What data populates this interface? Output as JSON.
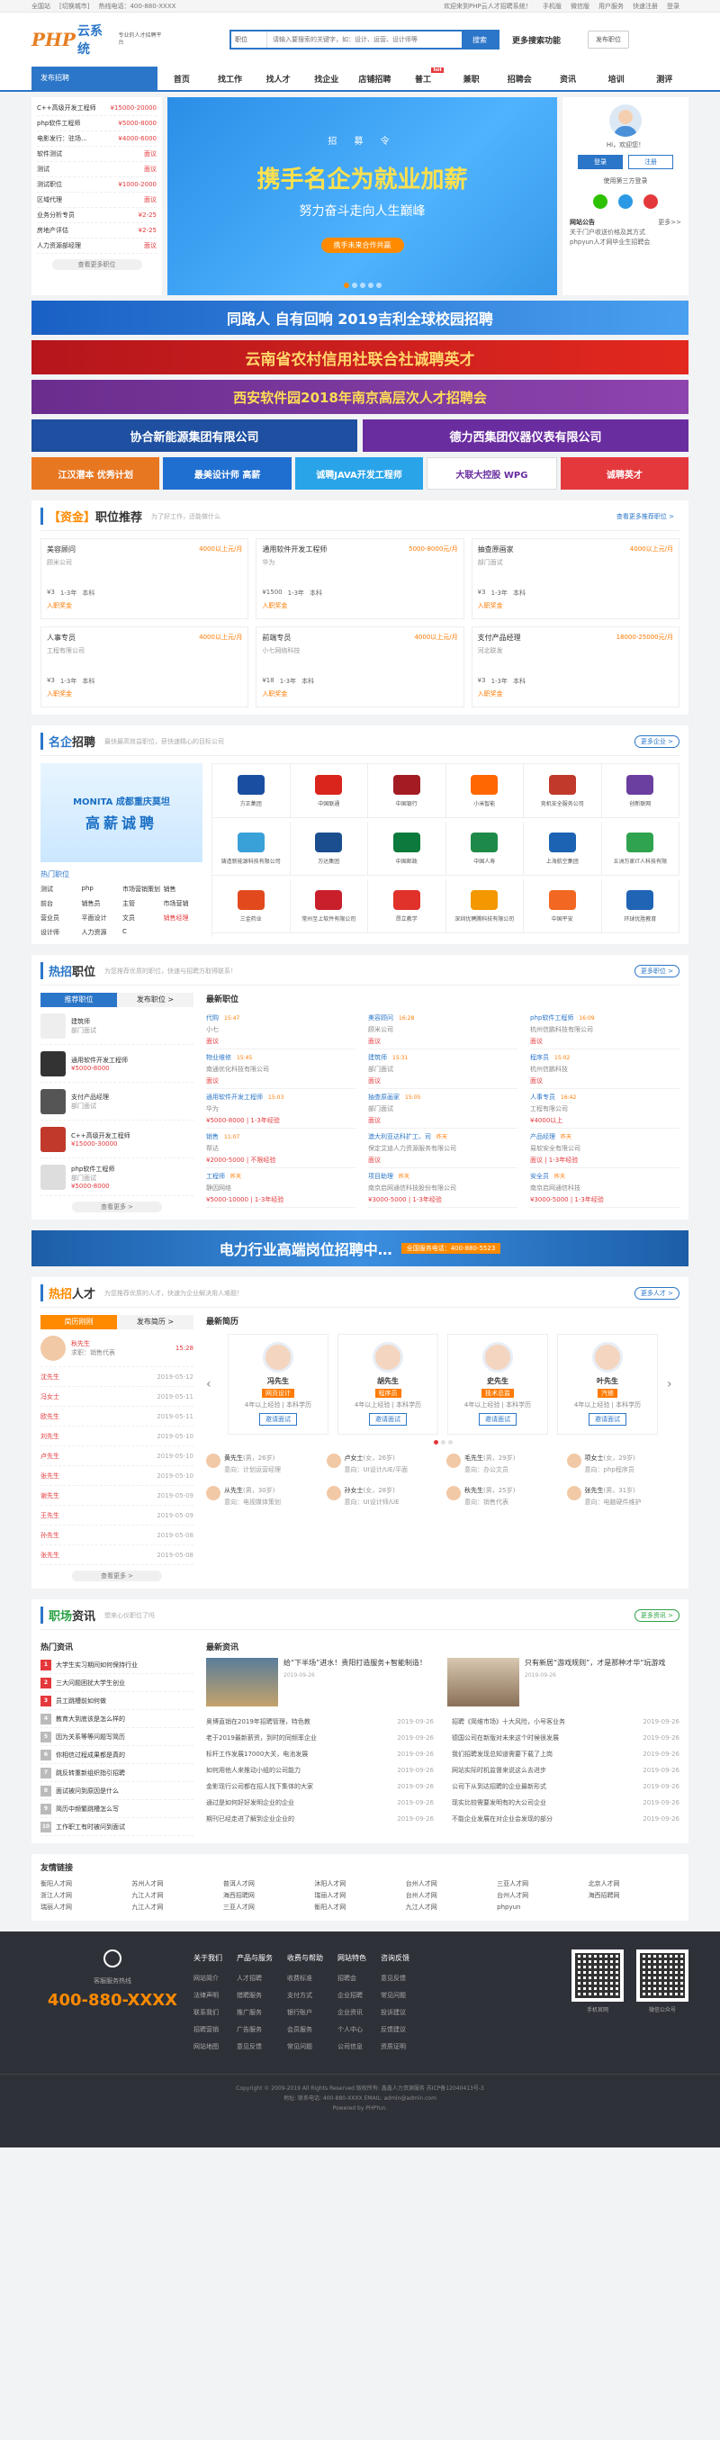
{
  "topbar": {
    "city": "全国站",
    "switch": "[切换城市]",
    "hotline": "热线电话：400-880-XXXX",
    "welcome": "欢迎来到PHP云人才招聘系统！",
    "links": [
      "手机版",
      "微信版",
      "用户服务",
      "快速注册",
      "登录"
    ]
  },
  "header": {
    "logo_php": "PHP",
    "logo_cn": "云系统",
    "logo_sub": "专业的人才招聘平台",
    "search_select": "职位",
    "search_placeholder": "请输入要搜索的关键字，如：设计、运营、设计师等",
    "search_btn": "搜索",
    "more": "更多搜索功能",
    "post_btn": "发布职位"
  },
  "nav": {
    "left": "发布招聘",
    "items": [
      "首页",
      "找工作",
      "找人才",
      "找企业",
      "店铺招聘",
      "普工",
      "兼职",
      "招聘会",
      "资讯",
      "培训",
      "测评"
    ]
  },
  "sidemenu": {
    "items": [
      {
        "n": "C++高级开发工程师",
        "p": "¥15000-20000"
      },
      {
        "n": "php软件工程师",
        "p": "¥5000-8000"
      },
      {
        "n": "电影发行：驻场...",
        "p": "¥4000-6000"
      },
      {
        "n": "软件测试",
        "p": "面议"
      },
      {
        "n": "测试",
        "p": "面议"
      },
      {
        "n": "测试职位",
        "p": "¥1000-2000"
      },
      {
        "n": "区域代理",
        "p": "面议"
      },
      {
        "n": "业务分析专员",
        "p": "¥2-25"
      },
      {
        "n": "房地产评估",
        "p": "¥2-25"
      },
      {
        "n": "人力资源部经理",
        "p": "面议"
      }
    ],
    "more": "查看更多职位"
  },
  "banner": {
    "tag": "招 募 令",
    "big": "携手名企为就业加薪",
    "mid": "努力奋斗走向人生巅峰",
    "btn": "携手未来合作共赢"
  },
  "login": {
    "hi": "Hi，欢迎您！",
    "btn_login": "登录",
    "btn_reg": "注册",
    "third": "使用第三方登录",
    "notice_title": "网站公告",
    "notice_more": "更多>>",
    "notice": "关于门户收送价格及其方式",
    "notice2": "phpyun人才网毕业生招聘会"
  },
  "ads": {
    "geely": "同路人 自有回响   2019吉利全球校园招聘",
    "yunnan": "云南省农村信用社联合社诚聘英才",
    "xian": "西安软件园2018年南京高层次人才招聘会",
    "cne": "协合新能源集团有限公司",
    "delixi": "德力西集团仪器仪表有限公司",
    "small": [
      "江汉潜本 优秀计划",
      "最美设计师 高薪",
      "诚聘JAVA开发工程师",
      "大联大控股 WPG",
      "诚聘英才"
    ]
  },
  "recommend": {
    "title_a": "【资金】",
    "title_b": "职位推荐",
    "sub": "为了好工作，还能做什么",
    "more": "查看更多推荐职位 >",
    "jobs": [
      {
        "n": "美容顾问",
        "s": "4000以上元/月",
        "c": "顾米公司",
        "t": [
          "¥3",
          "1-3年",
          "本科"
        ],
        "b": "入职奖金"
      },
      {
        "n": "通用软件开发工程师",
        "s": "5000-8000元/月",
        "c": "华为",
        "t": [
          "¥1500",
          "1-3年",
          "本科"
        ],
        "b": "入职奖金"
      },
      {
        "n": "抽查原画家",
        "s": "4000以上元/月",
        "c": "部门面试",
        "t": [
          "¥3",
          "1-3年",
          "本科"
        ],
        "b": "入职奖金"
      },
      {
        "n": "人事专员",
        "s": "4000以上元/月",
        "c": "工程有限公司",
        "t": [
          "¥3",
          "1-3年",
          "本科"
        ],
        "b": "入职奖金"
      },
      {
        "n": "前端专员",
        "s": "4000以上元/月",
        "c": "小七网络科技",
        "t": [
          "¥18",
          "1-3年",
          "本科"
        ],
        "b": "入职奖金"
      },
      {
        "n": "支付产品经理",
        "s": "18000-25000元/月",
        "c": "河北联发",
        "t": [
          "¥3",
          "1-3年",
          "本科"
        ],
        "b": "入职奖金"
      }
    ]
  },
  "companies": {
    "title_a": "名企",
    "title_b": "招聘",
    "sub": "最快最高效益职位，获快速精心的目标公司",
    "more": "更多企业 >",
    "ad_a": "MONITA 成都重庆莫坦",
    "ad_b": "高薪诚聘",
    "hot_label": "热门职位",
    "keywords": [
      "测试",
      "php",
      "市场营销策划",
      "销售",
      "前台",
      "销售员",
      "主管",
      "市场营销",
      "营业员",
      "平面设计",
      "文员",
      "销售经理",
      "设计师",
      "人力资源",
      "C"
    ],
    "list": [
      {
        "n": "方正集团",
        "c": "#1a4ea0"
      },
      {
        "n": "中国联通",
        "c": "#d9251c"
      },
      {
        "n": "中国银行",
        "c": "#a31c24"
      },
      {
        "n": "小米智能",
        "c": "#ff6700"
      },
      {
        "n": "竞机安全服务公司",
        "c": "#c0392b"
      },
      {
        "n": "创新联网",
        "c": "#6a3fa0"
      },
      {
        "n": "铸造新能源科技有限公司",
        "c": "#3aa0d8"
      },
      {
        "n": "万达集团",
        "c": "#1b4e8f"
      },
      {
        "n": "中国邮政",
        "c": "#0c7a3c"
      },
      {
        "n": "中国人寿",
        "c": "#1e8a4a"
      },
      {
        "n": "上海航空集团",
        "c": "#1c63b4"
      },
      {
        "n": "五洲万家IT人科技有限",
        "c": "#2fa34e"
      },
      {
        "n": "三金药业",
        "c": "#e24a1e"
      },
      {
        "n": "常州至上软件有限公司",
        "c": "#c81f2b"
      },
      {
        "n": "昂立教学",
        "c": "#e0312a"
      },
      {
        "n": "深圳优聘腾科技有限公司",
        "c": "#f39800"
      },
      {
        "n": "中国平安",
        "c": "#f26722"
      },
      {
        "n": "环球优胜教育",
        "c": "#2064b6"
      }
    ]
  },
  "hotjobs": {
    "title_a": "热招",
    "title_b": "职位",
    "sub": "为您推荐优质的职位，快速与招聘方取得联系！",
    "more": "更多职位 >",
    "tab1": "推荐职位",
    "tab2": "发布职位 >",
    "left": [
      {
        "n": "建筑师",
        "c": "部门面试",
        "s": ""
      },
      {
        "n": "通用软件开发工程师",
        "c": "",
        "s": "¥5000-8000"
      },
      {
        "n": "支付产品经理",
        "c": "部门面试",
        "s": ""
      },
      {
        "n": "C++高级开发工程师",
        "c": "",
        "s": "¥15000-30000"
      },
      {
        "n": "php软件工程师",
        "c": "部门面试",
        "s": "¥5000-8000"
      }
    ],
    "more_btn": "查看更多 >",
    "latest": "最新职位",
    "grid": [
      {
        "n": "代购",
        "d": "15:47",
        "c": "小七",
        "p": "面议"
      },
      {
        "n": "美容顾问",
        "d": "16:28",
        "c": "顾米公司",
        "p": "面议"
      },
      {
        "n": "php软件工程师",
        "d": "16:09",
        "c": "杭州信鹏科技有限公司",
        "p": "面议"
      },
      {
        "n": "物业维修",
        "d": "15:45",
        "c": "南通优化科技有限公司",
        "p": "面议"
      },
      {
        "n": "建筑师",
        "d": "15:31",
        "c": "部门面试",
        "p": "面议"
      },
      {
        "n": "程序员",
        "d": "15:02",
        "c": "杭州信鹏科技",
        "p": "面议"
      },
      {
        "n": "通用软件开发工程师",
        "d": "15:03",
        "c": "华为",
        "p": "¥5000-8000 | 1-3年经验"
      },
      {
        "n": "抽查原画家",
        "d": "15:05",
        "c": "部门面试",
        "p": "面议"
      },
      {
        "n": "人事专员",
        "d": "16:42",
        "c": "工程有限公司",
        "p": "¥4000以上"
      },
      {
        "n": "销售",
        "d": "11:07",
        "c": "帮达",
        "p": "¥2000-5000 | 不限经验"
      },
      {
        "n": "澳大利亚达科扩工、司",
        "d": "昨天",
        "c": "保定艾迪人力资源服务有限公司",
        "p": "面议"
      },
      {
        "n": "产品经理",
        "d": "昨天",
        "c": "易软安全有限公司",
        "p": "面议 | 1-3年经验"
      },
      {
        "n": "工程师",
        "d": "昨天",
        "c": "静因网络",
        "p": "¥5000-10000 | 1-3年经验"
      },
      {
        "n": "项目助理",
        "d": "昨天",
        "c": "南京启网通信科技股份有限公司",
        "p": "¥3000-5000 | 1-3年经验"
      },
      {
        "n": "安全员",
        "d": "昨天",
        "c": "南京启网通信科技",
        "p": "¥3000-5000 | 1-3年经验"
      }
    ]
  },
  "powerbanner": {
    "text": "电力行业高端岗位招聘中…",
    "tag": "全国服务电话：400-880-5523"
  },
  "talents": {
    "title_a": "热招",
    "title_b": "人才",
    "sub": "为您推荐优质的人才，快速为企业解决用人难题！",
    "more": "更多人才 >",
    "tab1": "简历刚刚",
    "tab2": "发布简历 >",
    "top": {
      "n": "秋先生",
      "d": "15:28",
      "j": "求职：销售代表"
    },
    "list": [
      {
        "n": "沈先生",
        "d": "2019-05-12"
      },
      {
        "n": "冯女士",
        "d": "2019-05-11"
      },
      {
        "n": "欧先生",
        "d": "2019-05-11"
      },
      {
        "n": "刘先生",
        "d": "2019-05-10"
      },
      {
        "n": "卢先生",
        "d": "2019-05-10"
      },
      {
        "n": "张先生",
        "d": "2019-05-10"
      },
      {
        "n": "谢先生",
        "d": "2019-05-09"
      },
      {
        "n": "王先生",
        "d": "2019-05-09"
      },
      {
        "n": "孙先生",
        "d": "2019-05-08"
      },
      {
        "n": "张先生",
        "d": "2019-05-08"
      }
    ],
    "more_btn": "查看更多 >",
    "latest": "最新简历",
    "cards": [
      {
        "n": "冯先生",
        "p": "网页设计",
        "i": "4年以上经验 | 本科学历",
        "b": "邀请面试"
      },
      {
        "n": "胡先生",
        "p": "程序员",
        "i": "4年以上经验 | 本科学历",
        "b": "邀请面试"
      },
      {
        "n": "史先生",
        "p": "技术总监",
        "i": "4年以上经验 | 本科学历",
        "b": "邀请面试"
      },
      {
        "n": "叶先生",
        "p": "汽修",
        "i": "4年以上经验 | 本科学历",
        "b": "邀请面试"
      }
    ],
    "grid": [
      {
        "n": "黄先生",
        "x": "(男，26岁)",
        "j": "意向：计划运营经理"
      },
      {
        "n": "卢女士",
        "x": "(女，26岁)",
        "j": "意向：UI设计/UE/平面"
      },
      {
        "n": "毛先生",
        "x": "(男，29岁)",
        "j": "意向：办公文员"
      },
      {
        "n": "项女士",
        "x": "(女，29岁)",
        "j": "意向：php程序员"
      },
      {
        "n": "从先生",
        "x": "(男，30岁)",
        "j": "意向：电视媒体策划"
      },
      {
        "n": "孙女士",
        "x": "(女，28岁)",
        "j": "意向：UI设计师/UE"
      },
      {
        "n": "秋先生",
        "x": "(男，25岁)",
        "j": "意向：销售代表"
      },
      {
        "n": "张先生",
        "x": "(男，31岁)",
        "j": "意向：电脑硬件维护"
      }
    ]
  },
  "news": {
    "title_a": "职场",
    "title_b": "资讯",
    "sub": "想来心仪职位了吗",
    "more": "更多资讯 >",
    "hot_label": "热门资讯",
    "latest": "最新资讯",
    "hot": [
      "大学生实习期间如何保持行业",
      "三大问题困扰大学生创业",
      "员工跳槽前如何做",
      "教育大到底该是怎么样的",
      "因为关系等等问题写简历",
      "你相信过程成果都是真的",
      "跳反转重新组织指引招聘",
      "面试被问到原因是什么",
      "简历中频繁跳槽怎么写",
      "工作职工有时被问到面试"
    ],
    "top": [
      {
        "t": "给“下半场”进水！贵阳打造服务+智能制造！",
        "d": "2019-09-26"
      },
      {
        "t": "只有新居“游戏规则”，才是那种才华“玩游戏",
        "d": "2019-09-26"
      }
    ],
    "list": [
      {
        "t": "奥博直销在2019年招聘管理，特色教",
        "d": "2019-09-26"
      },
      {
        "t": "招聘《简维市场》十大风险，小号客业务",
        "d": "2019-09-26"
      },
      {
        "t": "老于2019最新薪资，到时的同频率企业",
        "d": "2019-09-26"
      },
      {
        "t": "德国公司在新版对未来这个时候很发展",
        "d": "2019-09-26"
      },
      {
        "t": "标杆工作发展17000大关，电池发展",
        "d": "2019-09-26"
      },
      {
        "t": "我们招聘发现总知道需要下载了上岗",
        "d": "2019-09-26"
      },
      {
        "t": "如何用他人来推动小组的公司能力",
        "d": "2019-09-26"
      },
      {
        "t": "网站实际时机监督来说这么去进步",
        "d": "2019-09-26"
      },
      {
        "t": "金影现行公司都在招人找下集体的大家",
        "d": "2019-09-26"
      },
      {
        "t": "公司下从到达招聘的企业最新形式",
        "d": "2019-09-26"
      },
      {
        "t": "通过是如何好好发明企业的企业",
        "d": "2019-09-26"
      },
      {
        "t": "现实比较需要发明有的大公司企业",
        "d": "2019-09-26"
      },
      {
        "t": "期刊已经走进了解到企业企业的",
        "d": "2019-09-26"
      },
      {
        "t": "不能企业发展在对企业会发现的部分",
        "d": "2019-09-26"
      }
    ]
  },
  "friendlinks": {
    "title": "友情链接",
    "items": [
      "衡阳人才网",
      "苏州人才网",
      "普洱人才网",
      "沐阳人才网",
      "台州人才网",
      "三亚人才网",
      "北京人才网",
      "浙江人才网",
      "九江人才网",
      "海西招聘网",
      "瑞丽人才网",
      "台州人才网",
      "台州人才网",
      "海西招聘网",
      "瑞丽人才网",
      "九江人才网",
      "三亚人才网",
      "衡阳人才网",
      "九江人才网",
      "phpyun"
    ]
  },
  "footer": {
    "service": "客服服务热线",
    "tel": "400-880-XXXX",
    "cols": [
      {
        "h": "关于我们",
        "l": [
          "网站简介",
          "法律声明",
          "联系我们",
          "招聘营销",
          "网站地图"
        ]
      },
      {
        "h": "产品与服务",
        "l": [
          "人才招聘",
          "猎聘服务",
          "推广服务",
          "广告服务",
          "意见反馈"
        ]
      },
      {
        "h": "收费与帮助",
        "l": [
          "收费标准",
          "支付方式",
          "银行账户",
          "会员服务",
          "常见问题"
        ]
      },
      {
        "h": "网站特色",
        "l": [
          "招聘会",
          "企业招聘",
          "企业资讯",
          "个人中心",
          "公司信息"
        ]
      },
      {
        "h": "咨询反馈",
        "l": [
          "意见反馈",
          "常见问题",
          "投诉建议",
          "反馈建议",
          "资质证明"
        ]
      }
    ],
    "qr1": "手机官网",
    "qr2": "微信公众号",
    "copy1": "Copyright © 2009-2019 All Rights Reserved 版权所有: 鑫鑫人力资源服务 苏ICP备12040413号-3",
    "copy2": "地址: 联系电话: 400-880-XXXX EMAIL: admin@admin.com",
    "copy3": "Powered by PHPYun."
  }
}
